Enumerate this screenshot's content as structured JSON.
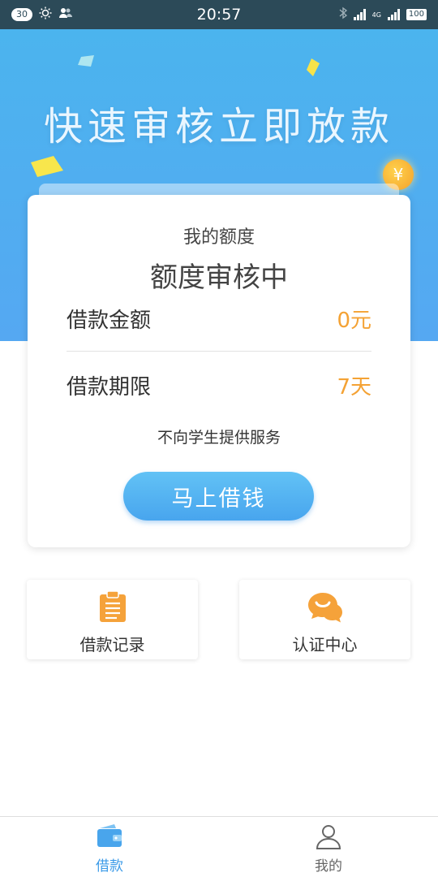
{
  "status_bar": {
    "notification_count": "30",
    "time": "20:57",
    "network_type": "4G",
    "battery": "100"
  },
  "hero": {
    "title": "快速审核立即放款"
  },
  "quota_card": {
    "subtitle": "我的额度",
    "status": "额度审核中",
    "amount_label": "借款金额",
    "amount_value": "0元",
    "term_label": "借款期限",
    "term_value": "7天",
    "notice": "不向学生提供服务",
    "borrow_button": "马上借钱"
  },
  "quick_actions": [
    {
      "label": "借款记录",
      "icon": "clipboard-icon"
    },
    {
      "label": "认证中心",
      "icon": "chat-bubble-icon"
    }
  ],
  "tab_bar": [
    {
      "label": "借款",
      "icon": "wallet-icon",
      "active": true
    },
    {
      "label": "我的",
      "icon": "user-icon",
      "active": false
    }
  ],
  "colors": {
    "primary_blue": "#4bb4ee",
    "accent_orange": "#f4a234",
    "status_bar": "#2c4a58"
  }
}
